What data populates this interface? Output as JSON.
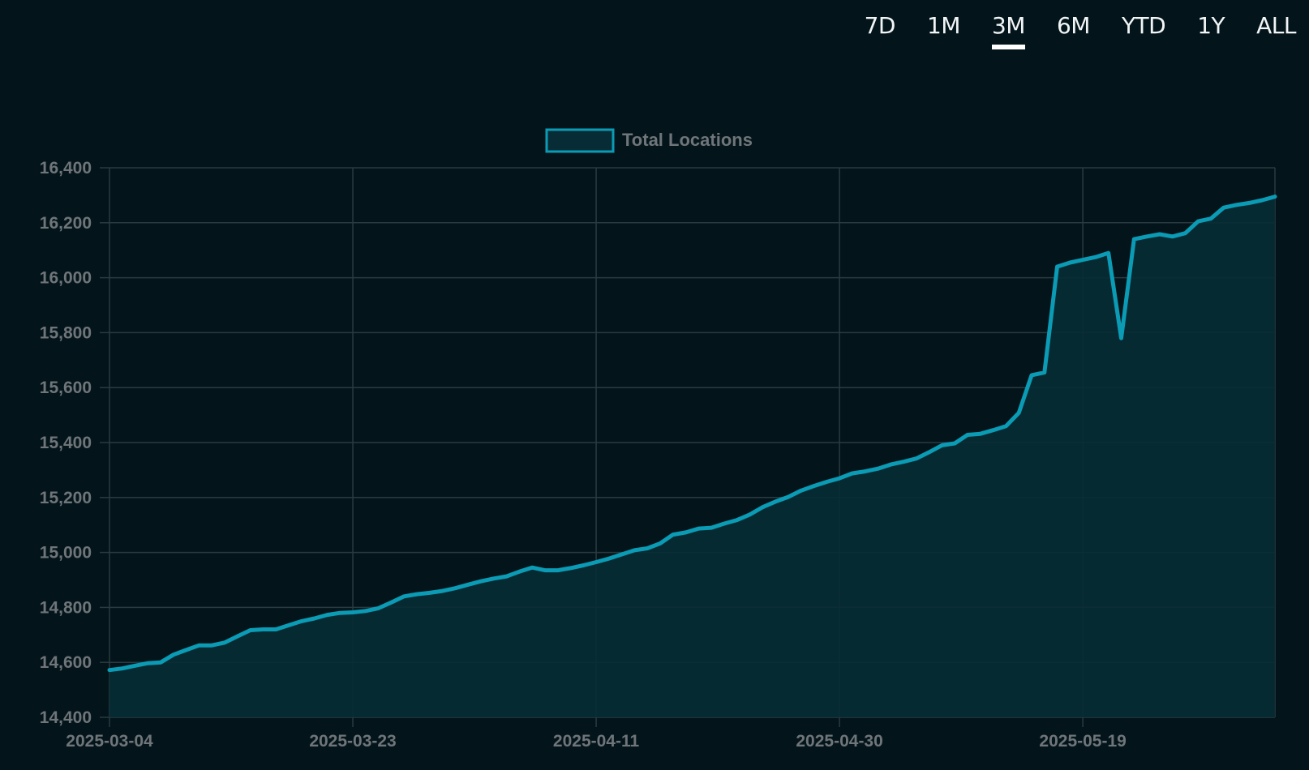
{
  "range_tabs": {
    "items": [
      {
        "label": "7D",
        "active": false
      },
      {
        "label": "1M",
        "active": false
      },
      {
        "label": "3M",
        "active": true
      },
      {
        "label": "6M",
        "active": false
      },
      {
        "label": "YTD",
        "active": false
      },
      {
        "label": "1Y",
        "active": false
      },
      {
        "label": "ALL",
        "active": false
      }
    ]
  },
  "colors": {
    "background": "#03151b",
    "line": "#0b9bb5",
    "fill": "#072c35",
    "grid": "#2a3b40",
    "tick_text": "#6f7579",
    "tab_text": "#f2f5f6",
    "active_indicator": "#ffffff"
  },
  "chart_data": {
    "type": "area",
    "legend": {
      "position": "top-center"
    },
    "grid": true,
    "x_tick_labels": [
      "2025-03-04",
      "2025-03-23",
      "2025-04-11",
      "2025-04-30",
      "2025-05-19"
    ],
    "y_tick_labels": [
      "14,400",
      "14,600",
      "14,800",
      "15,000",
      "15,200",
      "15,400",
      "15,600",
      "15,800",
      "16,000",
      "16,200",
      "16,400"
    ],
    "ylim": [
      14400,
      16400
    ],
    "xlim": [
      "2025-03-04",
      "2025-06-03"
    ],
    "series": [
      {
        "name": "Total Locations",
        "points": [
          [
            "2025-03-04",
            14572
          ],
          [
            "2025-03-05",
            14578
          ],
          [
            "2025-03-06",
            14588
          ],
          [
            "2025-03-07",
            14597
          ],
          [
            "2025-03-08",
            14600
          ],
          [
            "2025-03-09",
            14628
          ],
          [
            "2025-03-10",
            14645
          ],
          [
            "2025-03-11",
            14662
          ],
          [
            "2025-03-12",
            14662
          ],
          [
            "2025-03-13",
            14672
          ],
          [
            "2025-03-14",
            14695
          ],
          [
            "2025-03-15",
            14717
          ],
          [
            "2025-03-16",
            14720
          ],
          [
            "2025-03-17",
            14720
          ],
          [
            "2025-03-18",
            14735
          ],
          [
            "2025-03-19",
            14750
          ],
          [
            "2025-03-20",
            14760
          ],
          [
            "2025-03-21",
            14773
          ],
          [
            "2025-03-22",
            14780
          ],
          [
            "2025-03-23",
            14782
          ],
          [
            "2025-03-24",
            14787
          ],
          [
            "2025-03-25",
            14797
          ],
          [
            "2025-03-26",
            14818
          ],
          [
            "2025-03-27",
            14840
          ],
          [
            "2025-03-28",
            14848
          ],
          [
            "2025-03-29",
            14853
          ],
          [
            "2025-03-30",
            14860
          ],
          [
            "2025-03-31",
            14870
          ],
          [
            "2025-04-01",
            14883
          ],
          [
            "2025-04-02",
            14895
          ],
          [
            "2025-04-03",
            14905
          ],
          [
            "2025-04-04",
            14913
          ],
          [
            "2025-04-05",
            14930
          ],
          [
            "2025-04-06",
            14945
          ],
          [
            "2025-04-07",
            14935
          ],
          [
            "2025-04-08",
            14935
          ],
          [
            "2025-04-09",
            14943
          ],
          [
            "2025-04-10",
            14953
          ],
          [
            "2025-04-11",
            14965
          ],
          [
            "2025-04-12",
            14978
          ],
          [
            "2025-04-13",
            14993
          ],
          [
            "2025-04-14",
            15008
          ],
          [
            "2025-04-15",
            15015
          ],
          [
            "2025-04-16",
            15033
          ],
          [
            "2025-04-17",
            15065
          ],
          [
            "2025-04-18",
            15073
          ],
          [
            "2025-04-19",
            15087
          ],
          [
            "2025-04-20",
            15090
          ],
          [
            "2025-04-21",
            15105
          ],
          [
            "2025-04-22",
            15118
          ],
          [
            "2025-04-23",
            15138
          ],
          [
            "2025-04-24",
            15165
          ],
          [
            "2025-04-25",
            15185
          ],
          [
            "2025-04-26",
            15202
          ],
          [
            "2025-04-27",
            15225
          ],
          [
            "2025-04-28",
            15242
          ],
          [
            "2025-04-29",
            15257
          ],
          [
            "2025-04-30",
            15270
          ],
          [
            "2025-05-01",
            15288
          ],
          [
            "2025-05-02",
            15295
          ],
          [
            "2025-05-03",
            15305
          ],
          [
            "2025-05-04",
            15320
          ],
          [
            "2025-05-05",
            15330
          ],
          [
            "2025-05-06",
            15342
          ],
          [
            "2025-05-07",
            15365
          ],
          [
            "2025-05-08",
            15390
          ],
          [
            "2025-05-09",
            15397
          ],
          [
            "2025-05-10",
            15428
          ],
          [
            "2025-05-11",
            15432
          ],
          [
            "2025-05-12",
            15445
          ],
          [
            "2025-05-13",
            15460
          ],
          [
            "2025-05-14",
            15508
          ],
          [
            "2025-05-15",
            15645
          ],
          [
            "2025-05-16",
            15655
          ],
          [
            "2025-05-17",
            16040
          ],
          [
            "2025-05-18",
            16055
          ],
          [
            "2025-05-19",
            16065
          ],
          [
            "2025-05-20",
            16075
          ],
          [
            "2025-05-21",
            16090
          ],
          [
            "2025-05-22",
            15780
          ],
          [
            "2025-05-23",
            16140
          ],
          [
            "2025-05-24",
            16150
          ],
          [
            "2025-05-25",
            16158
          ],
          [
            "2025-05-26",
            16150
          ],
          [
            "2025-05-27",
            16162
          ],
          [
            "2025-05-28",
            16205
          ],
          [
            "2025-05-29",
            16215
          ],
          [
            "2025-05-30",
            16255
          ],
          [
            "2025-05-31",
            16265
          ],
          [
            "2025-06-01",
            16272
          ],
          [
            "2025-06-02",
            16282
          ],
          [
            "2025-06-03",
            16295
          ]
        ]
      }
    ]
  }
}
